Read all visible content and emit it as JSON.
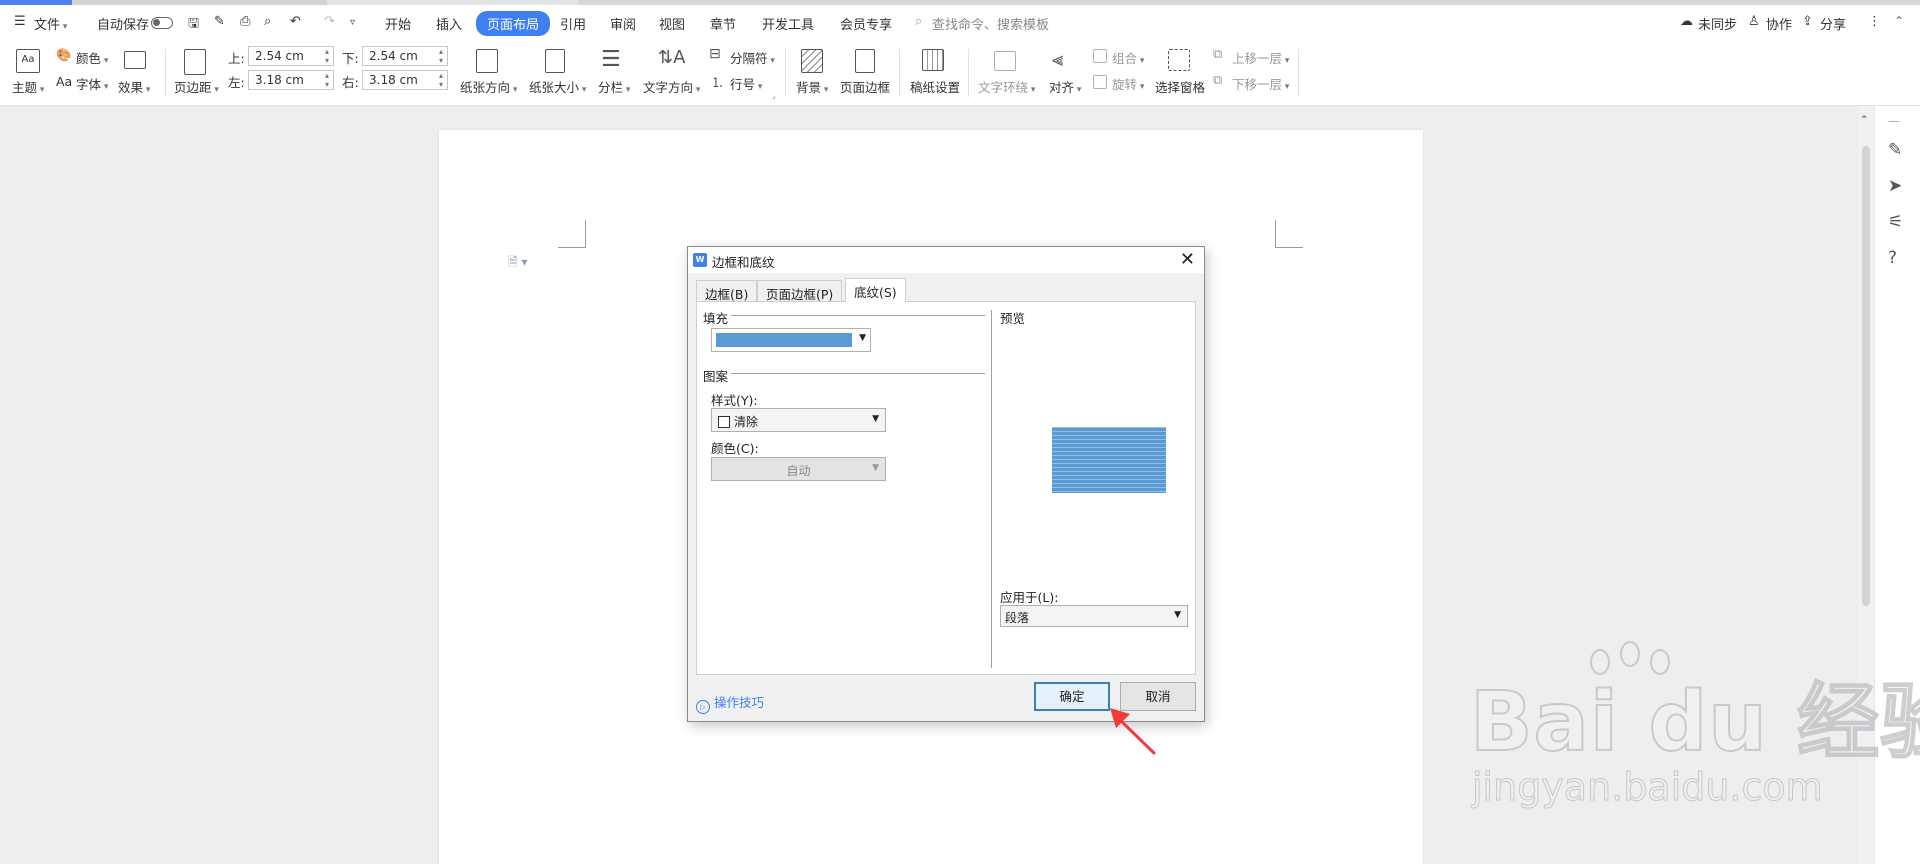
{
  "menubar": {
    "file": "文件",
    "autosave": "自动保存",
    "tabs": [
      "开始",
      "插入",
      "页面布局",
      "引用",
      "审阅",
      "视图",
      "章节",
      "开发工具",
      "会员专享"
    ],
    "active_tab": "页面布局",
    "search_placeholder": "查找命令、搜索模板",
    "sync": "未同步",
    "collab": "协作",
    "share": "分享"
  },
  "ribbon": {
    "theme": "主题",
    "colors": "颜色",
    "fonts_prefix": "Aa",
    "fonts": "字体",
    "effects": "效果",
    "margins": "页边距",
    "top_label": "上:",
    "top_value": "2.54 cm",
    "bottom_label": "下:",
    "bottom_value": "2.54 cm",
    "left_label": "左:",
    "left_value": "3.18 cm",
    "right_label": "右:",
    "right_value": "3.18 cm",
    "orientation": "纸张方向",
    "size": "纸张大小",
    "columns": "分栏",
    "text_direction": "文字方向",
    "breaks": "分隔符",
    "line_numbers": "行号",
    "background": "背景",
    "page_border": "页面边框",
    "manuscript": "稿纸设置",
    "text_wrap": "文字环绕",
    "align": "对齐",
    "group": "组合",
    "rotate": "旋转",
    "selection_pane": "选择窗格",
    "bring_forward": "上移一层",
    "send_backward": "下移一层"
  },
  "dialog": {
    "title": "边框和底纹",
    "logo": "W",
    "close": "✕",
    "tabs": [
      "边框(B)",
      "页面边框(P)",
      "底纹(S)"
    ],
    "active_tab": "底纹(S)",
    "fill_label": "填充",
    "fill_color": "#5b9bd5",
    "pattern_label": "图案",
    "style_label": "样式(Y):",
    "style_value": "清除",
    "color_label": "颜色(C):",
    "color_value": "自动",
    "preview_label": "预览",
    "apply_to_label": "应用于(L):",
    "apply_to_value": "段落",
    "tips": "操作技巧",
    "ok": "确定",
    "cancel": "取消"
  },
  "watermark": {
    "brand": "Bai  du 经验",
    "url": "jingyan.baidu.com"
  },
  "colors": {
    "accent": "#3f7ff2",
    "arrow": "#f03c3c"
  }
}
